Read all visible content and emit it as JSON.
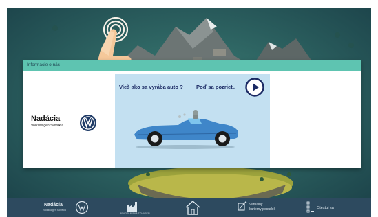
{
  "modal": {
    "header": "Informácie o nás",
    "brand": {
      "title": "Nadácia",
      "subtitle": "Volkswagen Slovakia"
    },
    "promo": {
      "question": "Vieš ako sa vyrába auto ?",
      "cta": "Poď sa pozrieť."
    }
  },
  "navbar": {
    "brand": {
      "title": "Nadácia",
      "subtitle": "Volkswagen Slovakia"
    },
    "factory_label": "BRATISLAVSKÁ TOVÁREŇ",
    "tour_label_line1": "Virtuálny",
    "tour_label_line2": "karierny posudok",
    "quiz_label": "Otestuj sa"
  },
  "icons": {
    "tap_gesture": "tap-gesture-icon",
    "play": "play-icon",
    "vw_logo": "vw-logo-icon",
    "factory": "factory-icon",
    "home": "home-icon",
    "tour": "tour-icon",
    "quiz": "quiz-icon"
  },
  "colors": {
    "modal_header": "#5ec4b1",
    "promo_bg": "#c3e0f1",
    "navbar": "#2d4a5f",
    "accent_text": "#1b2a64",
    "car": "#3f86c9"
  }
}
